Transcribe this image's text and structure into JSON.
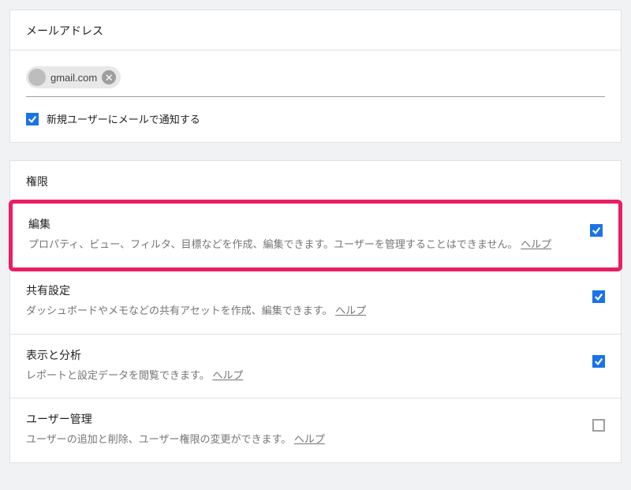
{
  "colors": {
    "accent": "#1a73e8",
    "highlight": "#e91e63"
  },
  "email_card": {
    "title": "メールアドレス",
    "chip": "gmail.com",
    "notify_label": "新規ユーザーにメールで通知する",
    "notify_checked": true
  },
  "perm_card": {
    "title": "権限",
    "items": [
      {
        "title": "編集",
        "desc_a": "プロパティ、ビュー、フィルタ、目標などを作成、編集できます。ユーザーを管理することはできません。",
        "help": "ヘルプ",
        "checked": true,
        "highlighted": true
      },
      {
        "title": "共有設定",
        "desc_a": "ダッシュボードやメモなどの共有アセットを作成、編集できます。",
        "help": "ヘルプ",
        "checked": true,
        "highlighted": false
      },
      {
        "title": "表示と分析",
        "desc_a": "レポートと設定データを閲覧できます。",
        "help": "ヘルプ",
        "checked": true,
        "highlighted": false
      },
      {
        "title": "ユーザー管理",
        "desc_a": "ユーザーの追加と削除、ユーザー権限の変更ができます。",
        "help": "ヘルプ",
        "checked": false,
        "highlighted": false
      }
    ]
  }
}
